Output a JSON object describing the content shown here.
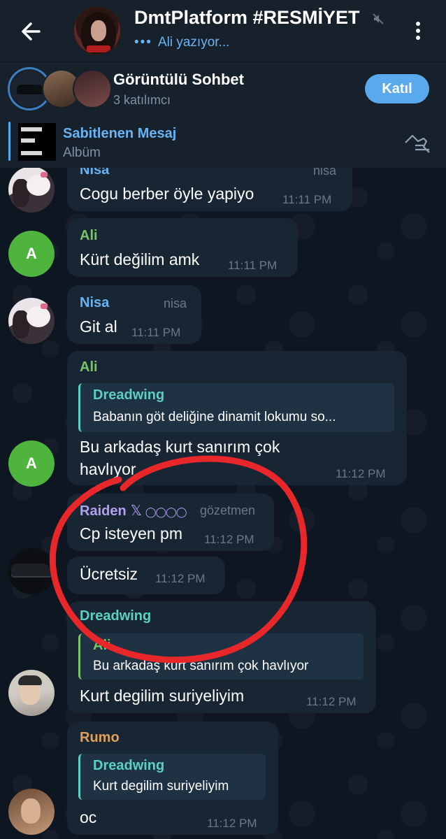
{
  "header": {
    "title": "DmtPlatform #RESMİYET",
    "typing_dots": "•••",
    "subtitle": "Ali yazıyor..."
  },
  "call": {
    "title": "Görüntülü Sohbet",
    "participants": "3 katılımcı",
    "join_label": "Katıl"
  },
  "pinned": {
    "title": "Sabitlenen Mesaj",
    "subtitle": "Albüm"
  },
  "messages": [
    {
      "sender": "Nisa",
      "role": "nisa",
      "text": "Cogu berber öyle yapiyo",
      "time": "11:11 PM"
    },
    {
      "sender": "Ali",
      "avatar_letter": "A",
      "text": "Kürt değilim amk",
      "time": "11:11 PM"
    },
    {
      "sender": "Nisa",
      "role": "nisa",
      "text": "Git al",
      "time": "11:11 PM"
    },
    {
      "sender": "Ali",
      "avatar_letter": "A",
      "reply_name": "Dreadwing",
      "reply_text": "Babanın göt deliğine dinamit lokumu so...",
      "text_line1": "Bu arkadaş kurt sanırım çok",
      "text_line2": "havlıyor",
      "time": "11:12 PM"
    },
    {
      "sender": "Raiden",
      "badge": "𝕏",
      "role": "gözetmen",
      "text": "Cp isteyen pm",
      "time": "11:12 PM"
    },
    {
      "text": "Ücretsiz",
      "time": "11:12 PM"
    },
    {
      "sender": "Dreadwing",
      "reply_name": "Ali",
      "reply_text": "Bu arkadaş kurt sanırım çok havlıyor",
      "text": "Kurt degilim suriyeliyim",
      "time": "11:12 PM"
    },
    {
      "sender": "Rumo",
      "reply_name": "Dreadwing",
      "reply_text": "Kurt degilim suriyeliyim",
      "text": "oc",
      "time": "11:12 PM"
    }
  ],
  "colors": {
    "accent": "#5aa9ec",
    "bubble": "#182533",
    "annotation": "#e8272b"
  }
}
